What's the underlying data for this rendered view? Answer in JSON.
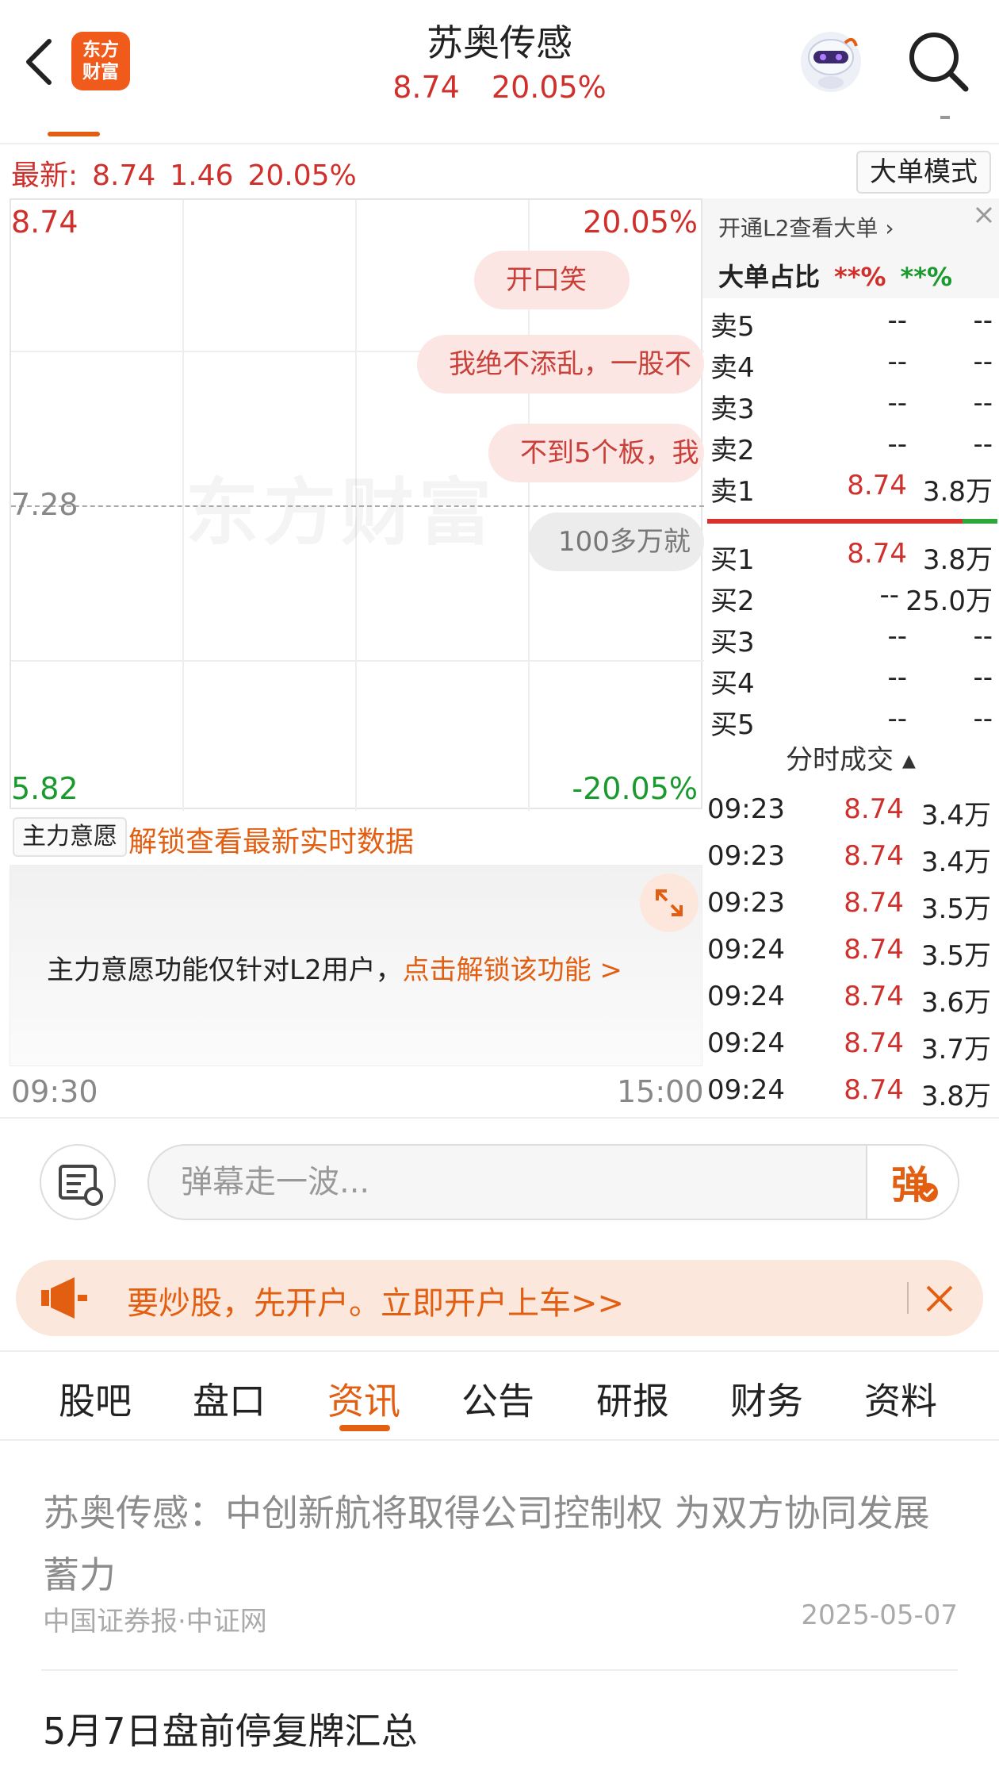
{
  "header": {
    "logo_line1": "东方",
    "logo_line2": "财富",
    "title": "苏奥传感",
    "price": "8.74",
    "change_pct": "20.05%"
  },
  "latest": {
    "label": "最新:",
    "price": "8.74",
    "change": "1.46",
    "change_pct": "20.05%",
    "mode_button": "大单模式"
  },
  "chart": {
    "high": "8.74",
    "high_pct": "20.05%",
    "mid": "7.28",
    "low": "5.82",
    "low_pct": "-20.05%",
    "watermark": "东方财富",
    "danmu": [
      "开口笑",
      "我绝不添乱，一股不",
      "不到5个板，我",
      "100多万就"
    ]
  },
  "orderbook": {
    "l2_link": "开通L2查看大单 ›",
    "ratio_label": "大单占比",
    "ratio_red": "**%",
    "ratio_green": "**%",
    "asks": [
      {
        "label": "卖5",
        "price": "--",
        "vol": "--"
      },
      {
        "label": "卖4",
        "price": "--",
        "vol": "--"
      },
      {
        "label": "卖3",
        "price": "--",
        "vol": "--"
      },
      {
        "label": "卖2",
        "price": "--",
        "vol": "--"
      },
      {
        "label": "卖1",
        "price": "8.74",
        "vol": "3.8万"
      }
    ],
    "bids": [
      {
        "label": "买1",
        "price": "8.74",
        "vol": "3.8万"
      },
      {
        "label": "买2",
        "price": "--",
        "vol": "25.0万"
      },
      {
        "label": "买3",
        "price": "--",
        "vol": "--"
      },
      {
        "label": "买4",
        "price": "--",
        "vol": "--"
      },
      {
        "label": "买5",
        "price": "--",
        "vol": "--"
      }
    ],
    "ticks_header": "分时成交 ▴",
    "ticks": [
      {
        "time": "09:23",
        "price": "8.74",
        "vol": "3.4万"
      },
      {
        "time": "09:23",
        "price": "8.74",
        "vol": "3.4万"
      },
      {
        "time": "09:23",
        "price": "8.74",
        "vol": "3.5万"
      },
      {
        "time": "09:24",
        "price": "8.74",
        "vol": "3.5万"
      },
      {
        "time": "09:24",
        "price": "8.74",
        "vol": "3.6万"
      },
      {
        "time": "09:24",
        "price": "8.74",
        "vol": "3.7万"
      },
      {
        "time": "09:24",
        "price": "8.74",
        "vol": "3.8万"
      }
    ]
  },
  "main_force": {
    "select": "主力意愿",
    "unlock": "解锁查看最新实时数据",
    "notice": "主力意愿功能仅针对L2用户，",
    "notice_link": "点击解锁该功能 >",
    "time_start": "09:30",
    "time_end": "15:00"
  },
  "comment": {
    "placeholder": "弹幕走一波...",
    "send_glyph": "弹"
  },
  "banner": {
    "text": "要炒股，先开户。立即开户上车>>"
  },
  "tabs": [
    "股吧",
    "盘口",
    "资讯",
    "公告",
    "研报",
    "财务",
    "资料"
  ],
  "active_tab": "资讯",
  "news": [
    {
      "title": "苏奥传感：中创新航将取得公司控制权 为双方协同发展蓄力",
      "source": "中国证券报·中证网",
      "date": "2025-05-07"
    },
    {
      "title": "5月7日盘前停复牌汇总",
      "source": "",
      "date": ""
    }
  ],
  "colors": {
    "accent": "#e25f12",
    "up": "#d0302c",
    "down": "#1a9a2e"
  }
}
